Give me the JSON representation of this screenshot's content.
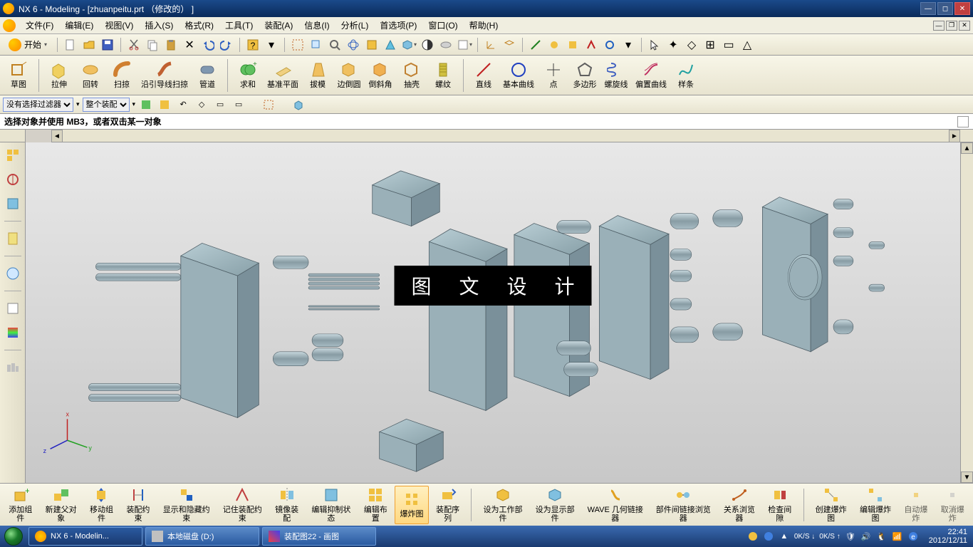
{
  "window": {
    "title": "NX 6 - Modeling - [zhuanpeitu.prt （修改的） ]"
  },
  "menu": {
    "items": [
      "文件(F)",
      "编辑(E)",
      "视图(V)",
      "插入(S)",
      "格式(R)",
      "工具(T)",
      "装配(A)",
      "信息(I)",
      "分析(L)",
      "首选项(P)",
      "窗口(O)",
      "帮助(H)"
    ]
  },
  "toolbar1": {
    "start": "开始"
  },
  "ribbon": {
    "items": [
      {
        "label": "草图",
        "c": "#c08020"
      },
      {
        "label": "拉伸",
        "c": "#d0a030"
      },
      {
        "label": "回转",
        "c": "#e08030"
      },
      {
        "label": "扫掠",
        "c": "#d07030"
      },
      {
        "label": "沿引导线扫掠",
        "c": "#c06030"
      },
      {
        "label": "管道",
        "c": "#6080a0"
      }
    ],
    "items2": [
      {
        "label": "求和",
        "c": "#30a030"
      },
      {
        "label": "基准平面",
        "c": "#d08030"
      },
      {
        "label": "拔模",
        "c": "#d0a030"
      },
      {
        "label": "边倒圆",
        "c": "#d09030"
      },
      {
        "label": "倒斜角",
        "c": "#d08030"
      },
      {
        "label": "抽壳",
        "c": "#c08030"
      },
      {
        "label": "螺纹",
        "c": "#b0b030"
      }
    ],
    "items3": [
      {
        "label": "直线",
        "c": "#c02020"
      },
      {
        "label": "基本曲线",
        "c": "#2040c0"
      },
      {
        "label": "点",
        "c": "#404040"
      },
      {
        "label": "多边形",
        "c": "#606060"
      },
      {
        "label": "螺旋线",
        "c": "#4060c0"
      },
      {
        "label": "偏置曲线",
        "c": "#c03060"
      },
      {
        "label": "样条",
        "c": "#20a0a0"
      }
    ]
  },
  "filter": {
    "sel1": "没有选择过滤器",
    "sel2": "整个装配"
  },
  "prompt": "选择对象并使用 MB3，或者双击某一对象",
  "watermark": "图 文 设 计",
  "bottom": {
    "items1": [
      {
        "label": "添加组件"
      },
      {
        "label": "新建父对象"
      },
      {
        "label": "移动组件"
      },
      {
        "label": "装配约束"
      },
      {
        "label": "显示和隐藏约束"
      },
      {
        "label": "记住装配约束"
      },
      {
        "label": "镜像装配"
      },
      {
        "label": "编辑抑制状态"
      },
      {
        "label": "编辑布置"
      },
      {
        "label": "爆炸图",
        "active": true
      },
      {
        "label": "装配序列"
      }
    ],
    "items2": [
      {
        "label": "设为工作部件"
      },
      {
        "label": "设为显示部件"
      },
      {
        "label": "WAVE 几何链接器"
      },
      {
        "label": "部件间链接浏览器"
      },
      {
        "label": "关系浏览器"
      },
      {
        "label": "检查间隙"
      }
    ],
    "items3": [
      {
        "label": "创建爆炸图"
      },
      {
        "label": "编辑爆炸图"
      },
      {
        "label": "自动爆炸"
      },
      {
        "label": "取消爆炸"
      }
    ]
  },
  "taskbar": {
    "items": [
      {
        "label": "NX 6 - Modelin...",
        "active": true
      },
      {
        "label": "本地磁盘 (D:)"
      },
      {
        "label": "装配图22 - 画图"
      }
    ],
    "net1": "0K/S ↓",
    "net2": "0K/S ↑",
    "time": "22:41",
    "date": "2012/12/11"
  }
}
